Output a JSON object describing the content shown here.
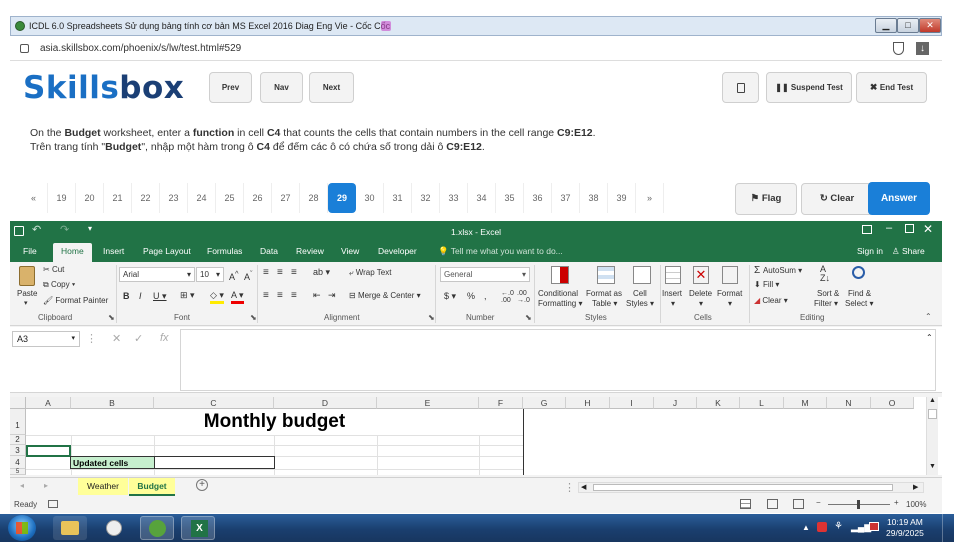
{
  "browser": {
    "title": "ICDL 6.0 Spreadsheets Sử dụng bảng tính cơ bản MS Excel 2016 Diag Eng Vie - Cốc Cốc",
    "url": "asia.skillsbox.com/phoenix/s/lw/test.html#529"
  },
  "skillsbox": {
    "logo_a": "Skills",
    "logo_b": "box",
    "prev": "Prev",
    "nav": "Nav",
    "next": "Next",
    "suspend": "Suspend Test",
    "end": "End Test",
    "q_en": {
      "p1": "On the ",
      "b1": "Budget",
      "p2": " worksheet, enter a ",
      "b2": "function",
      "p3": " in cell ",
      "b3": "C4",
      "p4": " that counts the cells that contain numbers in the cell range ",
      "b4": "C9:E12",
      "p5": "."
    },
    "q_vi": {
      "p1": "Trên trang tính \"",
      "b1": "Budget",
      "p2": "\", nhập một hàm trong ô ",
      "b2": "C4",
      "p3": " để đếm các ô có chứa số trong dải ô ",
      "b3": "C9:E12",
      "p4": "."
    },
    "pages": [
      "«",
      "19",
      "20",
      "21",
      "22",
      "23",
      "24",
      "25",
      "26",
      "27",
      "28",
      "29",
      "30",
      "31",
      "32",
      "33",
      "34",
      "35",
      "36",
      "37",
      "38",
      "39",
      "»"
    ],
    "current_page": "29",
    "flag": "Flag",
    "clear": "Clear",
    "answer": "Answer"
  },
  "excel": {
    "title": "1.xlsx - Excel",
    "tabs": [
      "File",
      "Home",
      "Insert",
      "Page Layout",
      "Formulas",
      "Data",
      "Review",
      "View",
      "Developer"
    ],
    "tell_me": "Tell me what you want to do...",
    "sign_in": "Sign in",
    "share": "Share",
    "ribbon": {
      "paste": "Paste",
      "cut": "Cut",
      "copy": "Copy",
      "format_painter": "Format Painter",
      "clipboard": "Clipboard",
      "font_name": "Arial",
      "font_size": "10",
      "font": "Font",
      "wrap_text": "Wrap Text",
      "merge_center": "Merge & Center",
      "alignment": "Alignment",
      "number_format": "General",
      "number": "Number",
      "conditional": "Conditional",
      "formatting": "Formatting",
      "format_as": "Format as",
      "table": "Table",
      "cell": "Cell",
      "styles_btn": "Styles",
      "styles": "Styles",
      "insert": "Insert",
      "delete": "Delete",
      "format": "Format",
      "cells": "Cells",
      "autosum": "AutoSum",
      "fill": "Fill",
      "clear": "Clear",
      "sort": "Sort &",
      "filter": "Filter",
      "find": "Find &",
      "select": "Select",
      "editing": "Editing"
    },
    "name_box": "A3",
    "columns": [
      "A",
      "B",
      "C",
      "D",
      "E",
      "F",
      "G",
      "H",
      "I",
      "J",
      "K",
      "L",
      "M",
      "N",
      "O"
    ],
    "rows": [
      "1",
      "2",
      "3",
      "4",
      "5"
    ],
    "cell_title": "Monthly budget",
    "cell_updated": "Updated cells",
    "sheets": [
      "Weather",
      "Budget"
    ],
    "active_sheet": "Budget",
    "status_ready": "Ready",
    "zoom": "100%"
  },
  "taskbar": {
    "time": "10:19 AM",
    "date": "29/9/2025"
  }
}
